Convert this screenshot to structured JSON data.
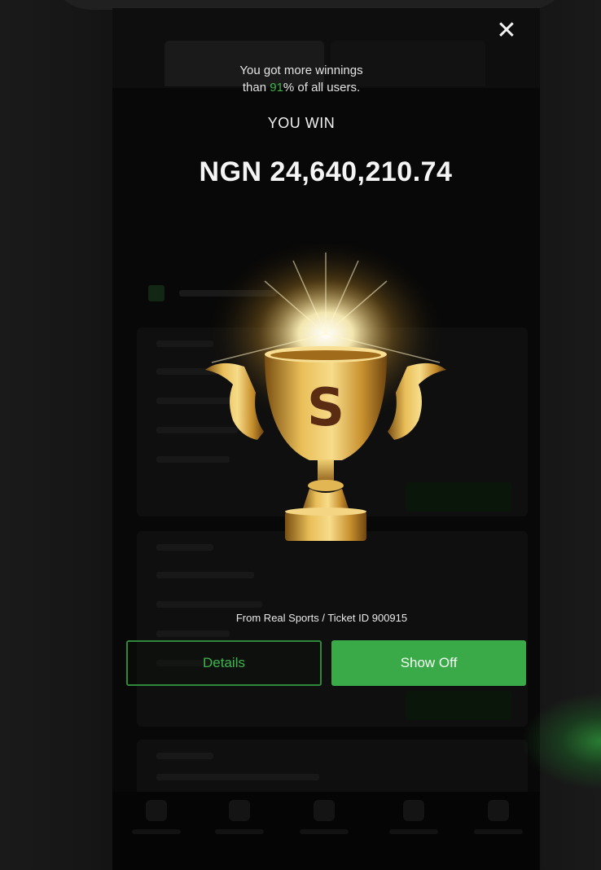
{
  "popup": {
    "close_icon": "close-icon",
    "percent_before": "You got more winnings",
    "percent_prefix": "than ",
    "percent_value": "91",
    "percent_suffix": "% of all users.",
    "you_win_label": "YOU WIN",
    "amount": "NGN 24,640,210.74",
    "trophy_icon": "trophy-icon",
    "ticket_line": "From Real Sports / Ticket ID 900915",
    "details_label": "Details",
    "show_off_label": "Show Off"
  },
  "colors": {
    "accent_green": "#3aa948",
    "percent_green": "#3cb34a",
    "trophy_gold": "#d4a23a"
  }
}
